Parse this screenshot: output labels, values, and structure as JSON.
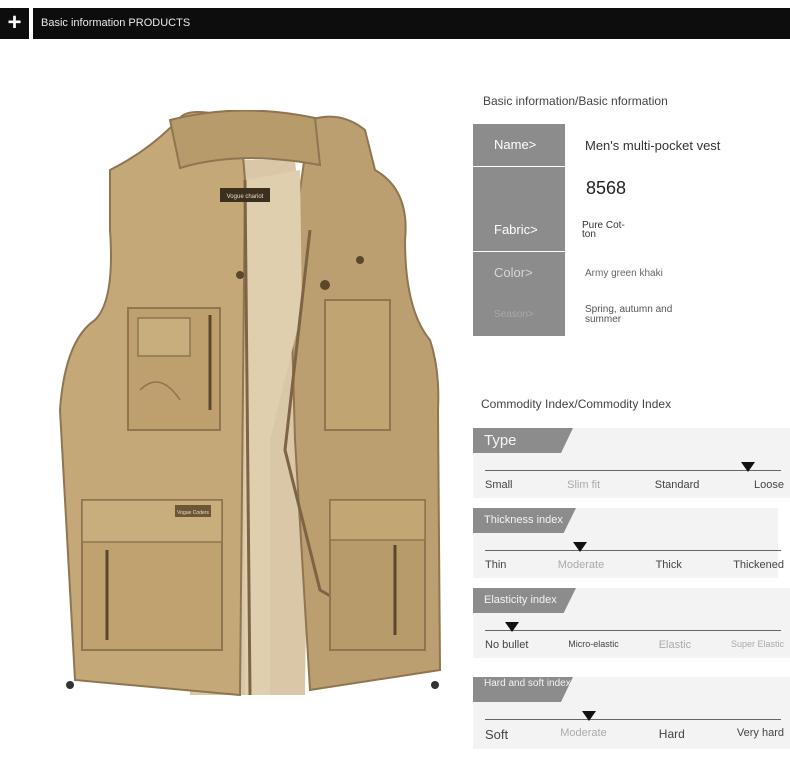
{
  "header": {
    "plus": "+",
    "title": "Basic information PRODUCTS"
  },
  "basic_info": {
    "title": "Basic information/Basic nformation",
    "rows": [
      {
        "label": "Name>",
        "value": "Men's multi-pocket vest"
      },
      {
        "label": "",
        "value": "8568"
      },
      {
        "label": "Fabric>",
        "value": "Pure Cot- ton"
      },
      {
        "label": "Color>",
        "value": "Army green khaki"
      },
      {
        "label": "Season>",
        "value": "Spring, autumn and summer"
      }
    ]
  },
  "commodity_index": {
    "title": "Commodity Index/Commodity Index",
    "scales": [
      {
        "name": "Type",
        "options": [
          "Small",
          "Slim fit",
          "Standard",
          "Loose"
        ],
        "selected_fraction": 0.89
      },
      {
        "name": "Thickness index",
        "options": [
          "Thin",
          "Moderate",
          "Thick",
          "Thickened"
        ],
        "selected_fraction": 0.32
      },
      {
        "name": "Elasticity index",
        "options": [
          "No bullet",
          "Micro-elastic",
          "Elastic",
          "Super Elastic"
        ],
        "selected_fraction": 0.09
      },
      {
        "name": "Hard and soft index",
        "options": [
          "Soft",
          "Moderate",
          "Hard",
          "Very hard"
        ],
        "selected_fraction": 0.35
      }
    ]
  },
  "product_image": {
    "patch_text": "Vogue chariot",
    "label_text": "Vogue Coders"
  },
  "colors": {
    "header_bg": "#0d0d0d",
    "label_bg": "#8c8c8c",
    "vest_khaki": "#c4a878"
  }
}
